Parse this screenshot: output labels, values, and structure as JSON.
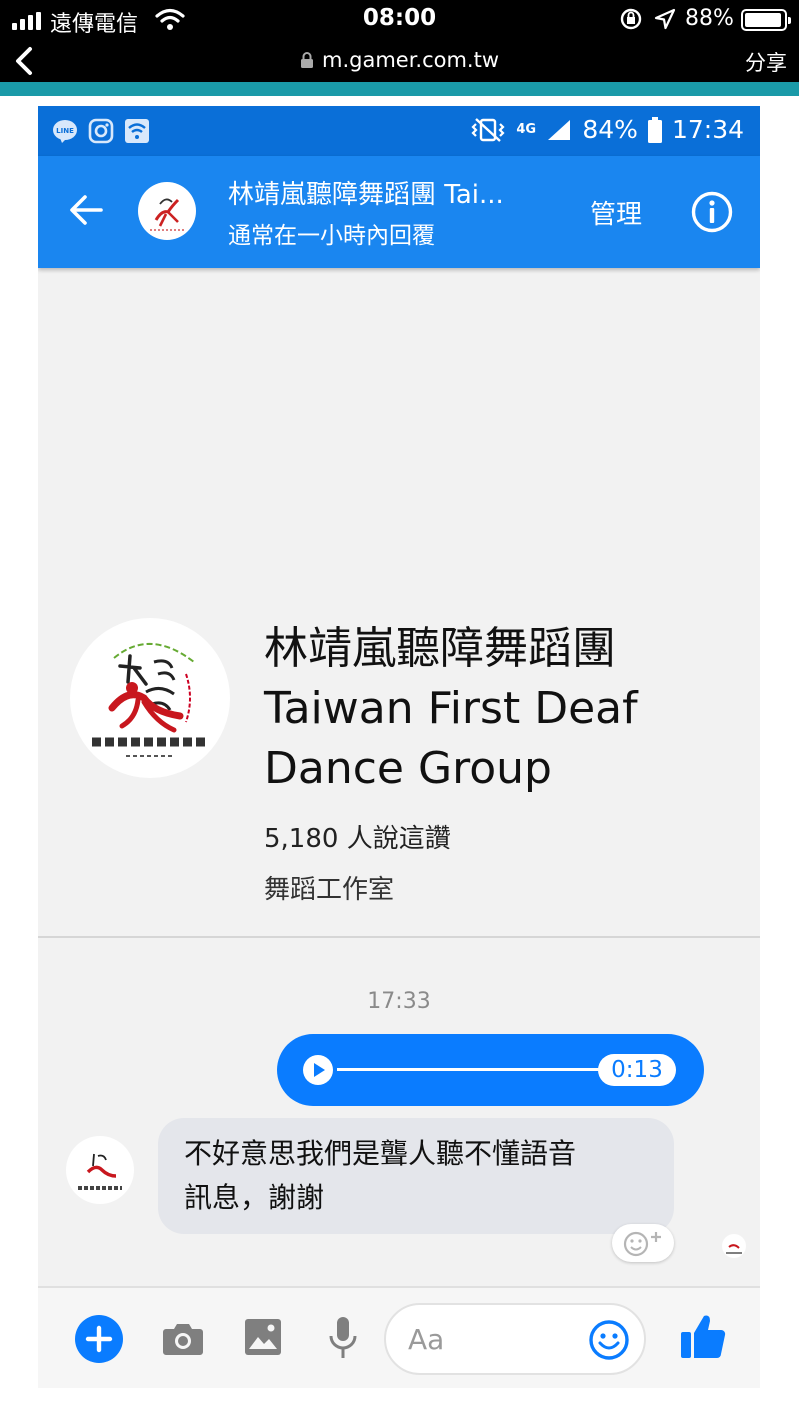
{
  "ios_status": {
    "carrier": "遠傳電信",
    "time": "08:00",
    "battery_percent": "88%"
  },
  "browser": {
    "url": "m.gamer.com.tw",
    "share_label": "分享"
  },
  "android_status": {
    "network": "4G",
    "battery_percent": "84%",
    "time": "17:34"
  },
  "chat_header": {
    "title": "林靖嵐聽障舞蹈團 Tai...",
    "subtitle": "通常在一小時內回覆",
    "manage_label": "管理"
  },
  "page_card": {
    "name_line1": "林靖嵐聽障舞蹈團",
    "name_line2": "Taiwan First Deaf",
    "name_line3": "Dance Group",
    "likes": "5,180 人說這讚",
    "category": "舞蹈工作室"
  },
  "messages": {
    "timestamp": "17:33",
    "voice_duration": "0:13",
    "incoming_line1": "不好意思我們是聾人聽不懂語音",
    "incoming_line2": "訊息，謝謝"
  },
  "composer": {
    "placeholder": "Aa"
  },
  "colors": {
    "messenger_blue": "#1a86f0",
    "android_status_blue": "#0a6fd8",
    "bubble_blue": "#0a7cff",
    "browser_teal": "#1a9aa8"
  }
}
